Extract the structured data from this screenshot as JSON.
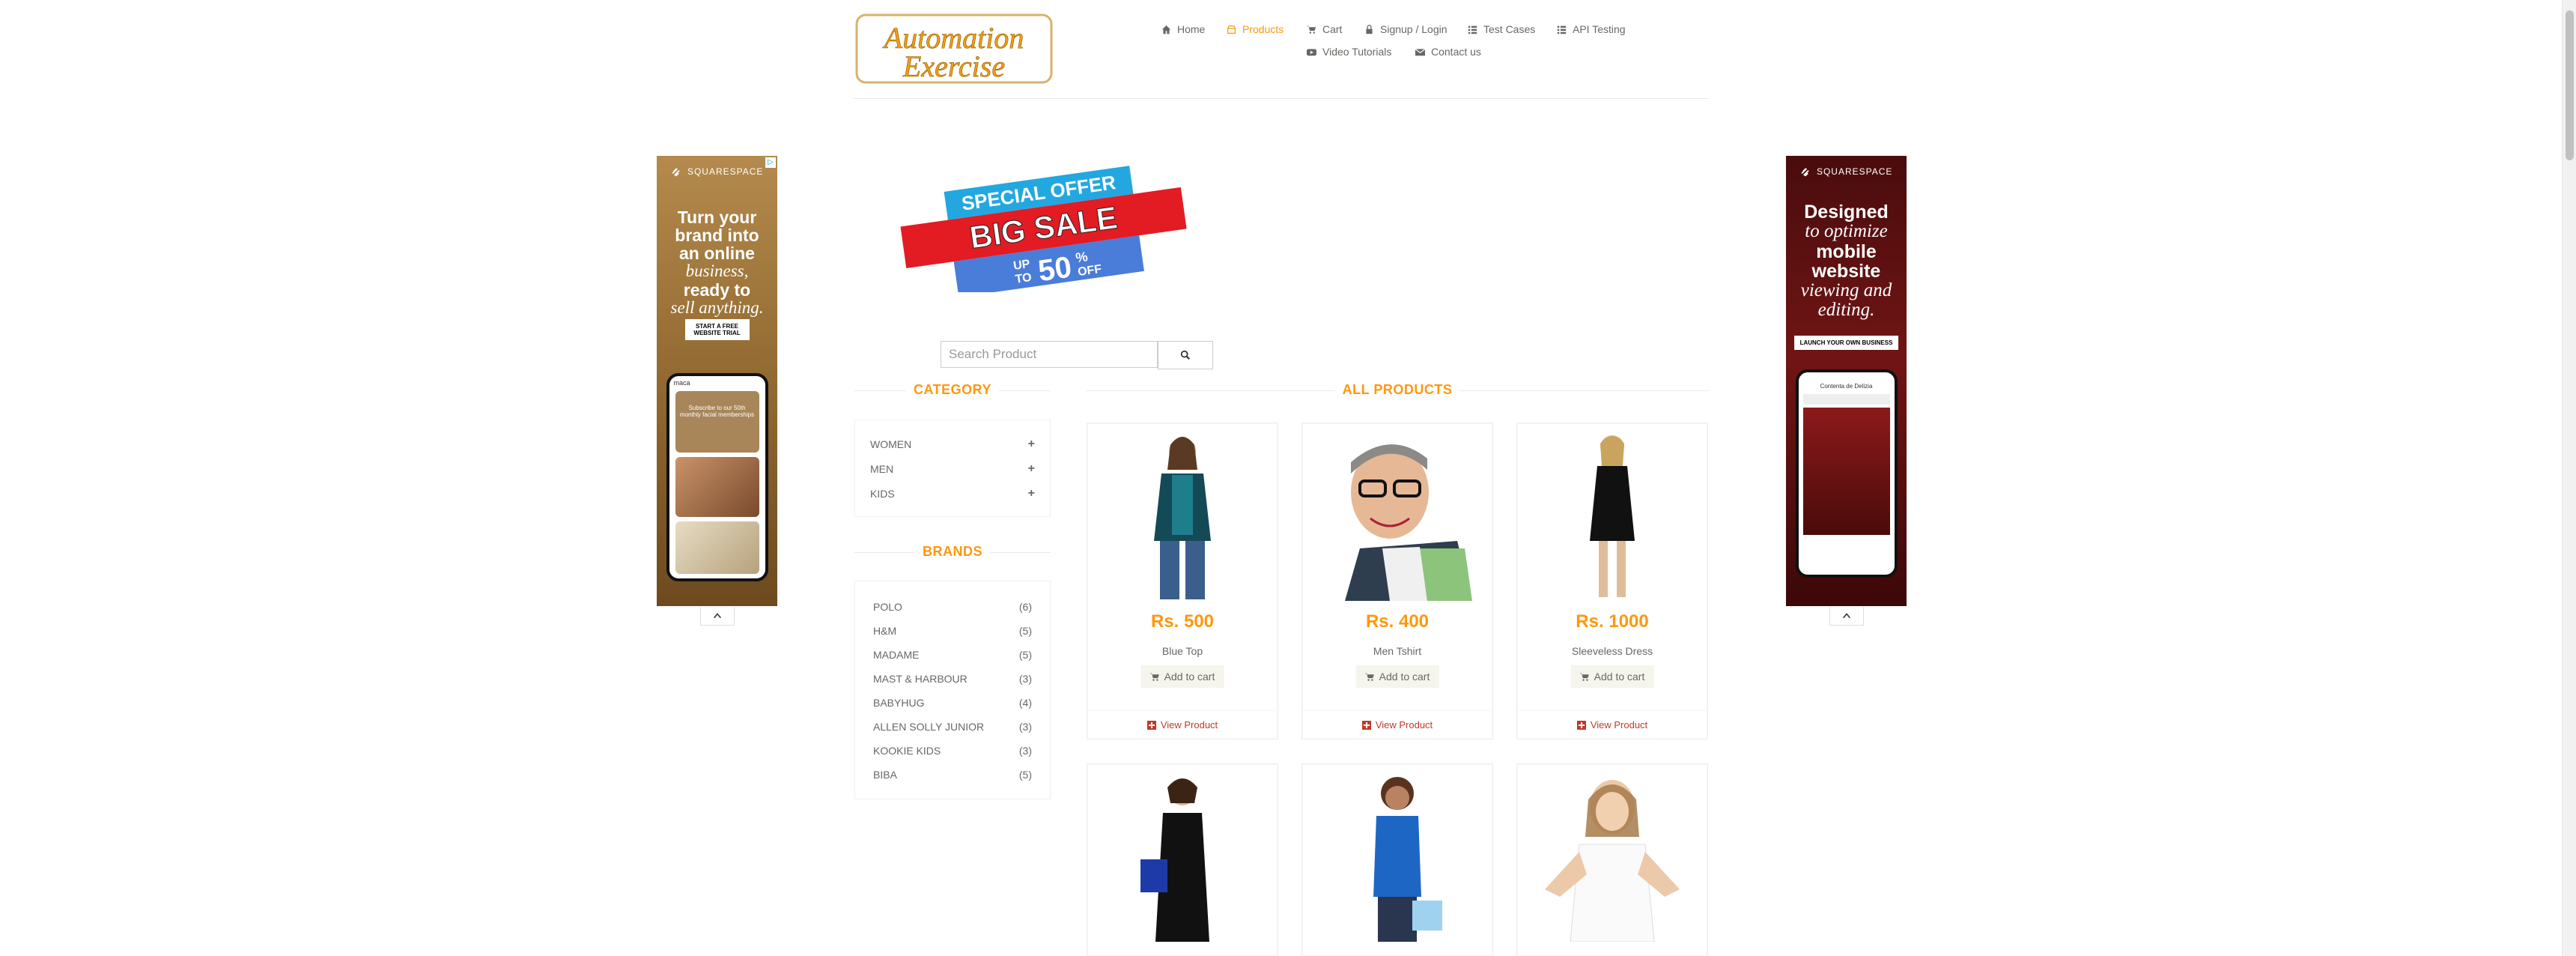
{
  "header": {
    "logo_text_1": "Automation",
    "logo_text_2": "Exercise",
    "nav": [
      {
        "label": "Home",
        "icon": "home-icon"
      },
      {
        "label": "Products",
        "icon": "products-icon",
        "active": true
      },
      {
        "label": "Cart",
        "icon": "cart-icon"
      },
      {
        "label": "Signup / Login",
        "icon": "lock-icon"
      },
      {
        "label": "Test Cases",
        "icon": "list-icon"
      },
      {
        "label": "API Testing",
        "icon": "list-icon"
      },
      {
        "label": "Video Tutorials",
        "icon": "youtube-icon"
      },
      {
        "label": "Contact us",
        "icon": "envelope-icon"
      }
    ]
  },
  "ads": {
    "left": {
      "brand": "SQUARESPACE",
      "headline_1": "Turn your",
      "headline_2": "brand into",
      "headline_3": "an online",
      "headline_4": "business,",
      "headline_5": "ready to",
      "headline_6": "sell anything.",
      "cta": "START A FREE WEBSITE TRIAL",
      "phone_brand": "maca",
      "phone_text": "Subscribe to our 50th monthly facial memberships"
    },
    "right": {
      "brand": "SQUARESPACE",
      "headline_1": "Designed",
      "headline_2": "to optimize",
      "headline_3": "mobile",
      "headline_4": "website",
      "headline_5": "viewing and",
      "headline_6": "editing.",
      "cta": "LAUNCH YOUR OWN BUSINESS",
      "phone_text": "Contenta de Delizia"
    }
  },
  "banner": {
    "line1": "SPECIAL OFFER",
    "line2": "BIG SALE",
    "line3_a": "UP",
    "line3_b": "TO",
    "line3_c": "50",
    "line3_d": "%",
    "line3_e": "OFF"
  },
  "search": {
    "placeholder": "Search Product"
  },
  "sidebar": {
    "category_title": "CATEGORY",
    "categories": [
      "WOMEN",
      "MEN",
      "KIDS"
    ],
    "brands_title": "BRANDS",
    "brands": [
      {
        "name": "POLO",
        "count": "(6)"
      },
      {
        "name": "H&M",
        "count": "(5)"
      },
      {
        "name": "MADAME",
        "count": "(5)"
      },
      {
        "name": "MAST & HARBOUR",
        "count": "(3)"
      },
      {
        "name": "BABYHUG",
        "count": "(4)"
      },
      {
        "name": "ALLEN SOLLY JUNIOR",
        "count": "(3)"
      },
      {
        "name": "KOOKIE KIDS",
        "count": "(3)"
      },
      {
        "name": "BIBA",
        "count": "(5)"
      }
    ]
  },
  "products": {
    "title": "ALL PRODUCTS",
    "add_to_cart": "Add to cart",
    "view_product": "View Product",
    "items": [
      {
        "price": "Rs. 500",
        "name": "Blue Top"
      },
      {
        "price": "Rs. 400",
        "name": "Men Tshirt"
      },
      {
        "price": "Rs. 1000",
        "name": "Sleeveless Dress"
      }
    ]
  },
  "colors": {
    "accent": "#FE980F",
    "text": "#696763",
    "link": "#c0392b"
  }
}
